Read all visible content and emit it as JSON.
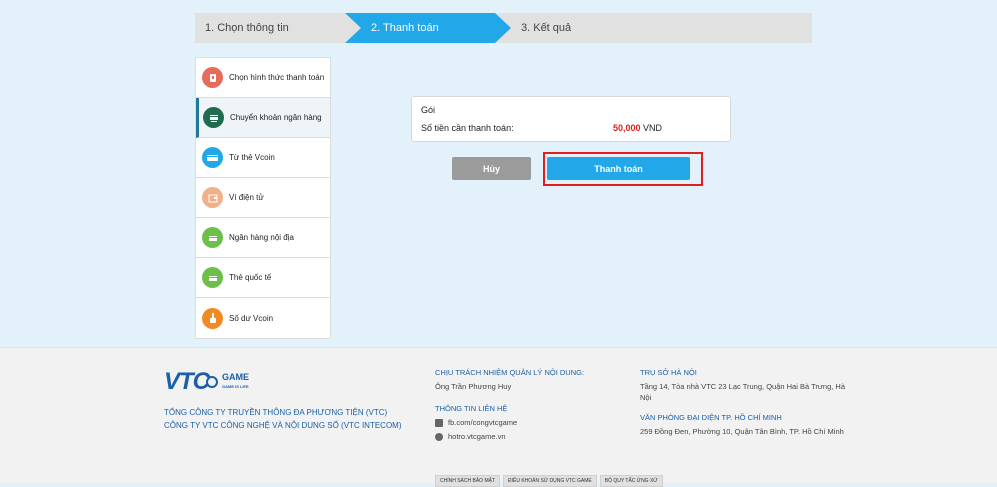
{
  "steps": {
    "step1": "1. Chọn thông tin",
    "step2": "2. Thanh toán",
    "step3": "3. Kết quả",
    "active_color": "#22a8e8"
  },
  "sidebar": {
    "items": [
      {
        "label": "Chọn hình thức thanh toán",
        "icon": "payment-method-icon",
        "color": "#e86a5a"
      },
      {
        "label": "Chuyển khoản ngân hàng",
        "icon": "bank-transfer-icon",
        "color": "#1f6b4f"
      },
      {
        "label": "Từ thẻ Vcoin",
        "icon": "vcoin-card-icon",
        "color": "#22a8e8"
      },
      {
        "label": "Ví điện tử",
        "icon": "e-wallet-icon",
        "color": "#f0b089"
      },
      {
        "label": "Ngân hàng nội địa",
        "icon": "domestic-bank-icon",
        "color": "#6cc04a"
      },
      {
        "label": "Thẻ quốc tế",
        "icon": "international-card-icon",
        "color": "#6cc04a"
      },
      {
        "label": "Số dư Vcoin",
        "icon": "vcoin-balance-icon",
        "color": "#f08a24"
      }
    ],
    "active_index": 1
  },
  "panel": {
    "package_label": "Gói",
    "amount_label": "Số tiền cần thanh toán:",
    "amount_value": "50,000",
    "currency": "VND"
  },
  "buttons": {
    "cancel": "Hủy",
    "pay": "Thanh toán"
  },
  "footer": {
    "logo_text": "VTC",
    "logo_game": "GAME",
    "logo_sub": "GAME IS LIFE",
    "corp_line1": "TỔNG CÔNG TY TRUYỀN THÔNG ĐA PHƯƠNG TIỆN (VTC)",
    "corp_line2": "CÔNG TY VTC CÔNG NGHỆ VÀ NỘI DUNG SỐ (VTC INTECOM)",
    "content_head": "CHỊU TRÁCH NHIỆM QUẢN LÝ NỘI DUNG:",
    "content_person": "Ông Trần Phương Huy",
    "contact_head": "THÔNG TIN LIÊN HỆ",
    "facebook": "fb.com/congvtcgame",
    "website": "hotro.vtcgame.vn",
    "hq_head": "TRỤ SỞ HÀ NỘI",
    "hq_address": "Tầng 14, Tòa nhà VTC 23 Lạc Trung, Quận Hai Bà Trưng, Hà Nội",
    "hcm_head": "VĂN PHÒNG ĐẠI DIỆN TP. HỒ CHÍ MINH",
    "hcm_address": "259 Đồng Đen, Phường 10, Quận Tân Bình, TP. Hồ Chí Minh",
    "links": [
      "CHÍNH SÁCH BẢO MẬT",
      "ĐIỀU KHOẢN SỬ DỤNG VTC GAME",
      "BỘ QUY TẮC ỨNG XỬ"
    ]
  }
}
